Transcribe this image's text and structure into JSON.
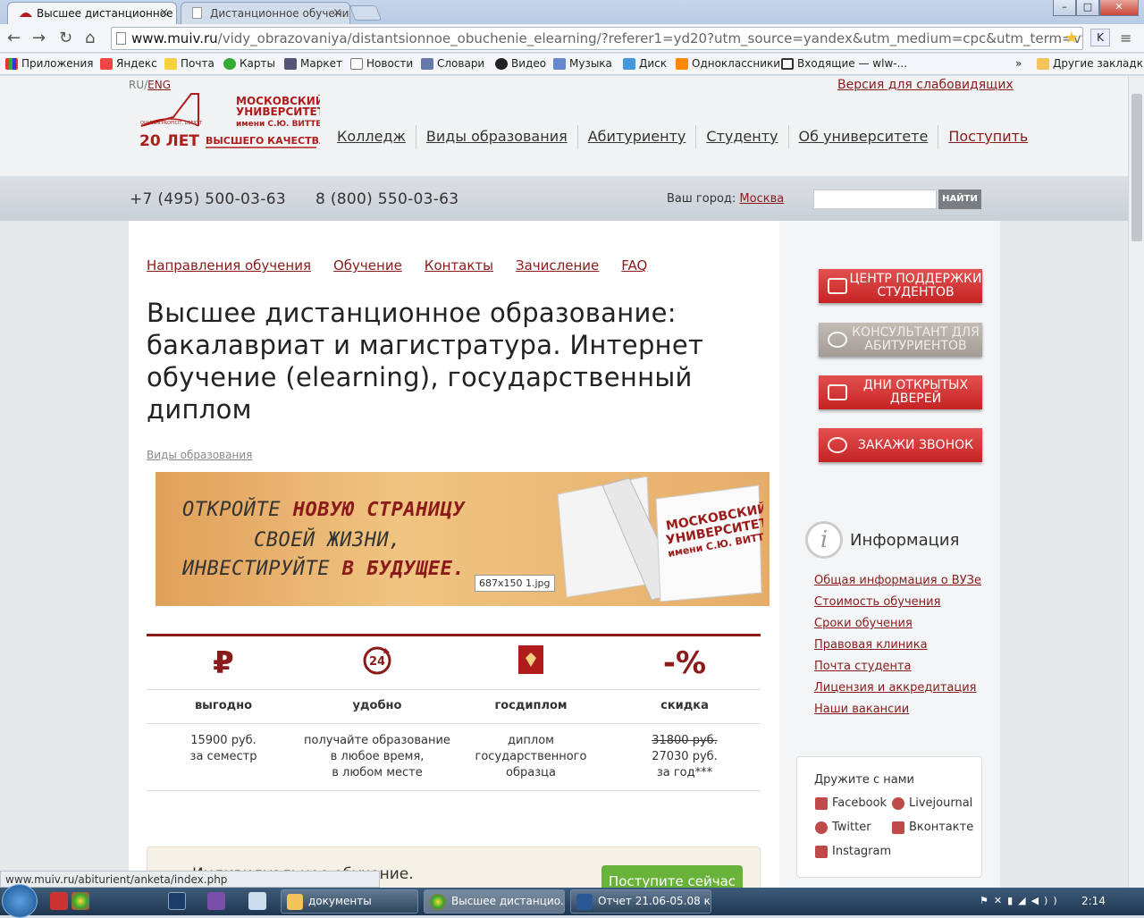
{
  "browser": {
    "tabs": [
      {
        "title": "Высшее дистанционное"
      },
      {
        "title": "Дистанционное обучени"
      }
    ],
    "url_domain": "www.muiv.ru",
    "url_rest": "/vidy_obrazovaniya/distantsionnoe_obuchenie_elearning/?referer1=yd20?utm_source=yandex&utm_medium=cpc&utm_term=vysshee_",
    "bookmarks": [
      "Приложения",
      "Яндекс",
      "Почта",
      "Карты",
      "Маркет",
      "Новости",
      "Словари",
      "Видео",
      "Музыка",
      "Диск",
      "Одноклассники",
      "Входящие — wlw-..."
    ],
    "bookmarks_more": "»",
    "other_bookmarks": "Другие закладки",
    "ext_label": "K",
    "status_url": "www.muiv.ru/abiturient/anketa/index.php"
  },
  "header": {
    "lang_ru": "RU",
    "lang_sep": "/",
    "lang_en": "ENG",
    "low_vision": "Версия для слабовидящих",
    "logo_line1": "МОСКОВСКИЙ",
    "logo_line2": "УНИВЕРСИТЕТ",
    "logo_line3": "имени С.Ю. ВИТТЕ",
    "logo_motto": "QUI NON PROFICIT, DEFICIT",
    "logo_years": "20 ЛЕТ",
    "logo_quality": "ВЫСШЕГО КАЧЕСТВА",
    "nav": [
      "Колледж",
      "Виды образования",
      "Абитуриенту",
      "Студенту",
      "Об университете",
      "Поступить"
    ]
  },
  "phonebar": {
    "phone1": "+7 (495) 500-03-63",
    "phone2": "8 (800) 550-03-63",
    "city_label": "Ваш город:",
    "city": "Москва",
    "search_button": "НАЙТИ"
  },
  "content": {
    "subnav": [
      "Направления обучения",
      "Обучение",
      "Контакты",
      "Зачисление",
      "FAQ"
    ],
    "title": "Высшее дистанционное образование: бакалавриат и магистратура. Интернет обучение (elearning), государственный диплом",
    "breadcrumb": "Виды образования",
    "banner_line1a": "ОТКРОЙТЕ ",
    "banner_line1b": "НОВУЮ СТРАНИЦУ",
    "banner_line2": "СВОЕЙ ЖИЗНИ,",
    "banner_line3a": "ИНВЕСТИРУЙТЕ ",
    "banner_line3b": "В БУДУЩЕЕ.",
    "banner_book_1": "МОСКОВСКИЙ",
    "banner_book_2": "УНИВЕРСИТЕТ",
    "banner_book_3": "имени С.Ю. ВИТТЕ",
    "banner_tooltip": "687x150 1.jpg",
    "features": [
      {
        "icon": "₽",
        "title": "выгодно",
        "l1": "15900 руб.",
        "l2": "за семестр",
        "l3": ""
      },
      {
        "icon": "24",
        "title": "удобно",
        "l1": "получайте образование",
        "l2": "в любое время,",
        "l3": "в любом месте"
      },
      {
        "icon": "",
        "title": "госдиплом",
        "l1": "диплом",
        "l2": "государственного",
        "l3": "образца"
      },
      {
        "icon": "-%",
        "title": "скидка",
        "l1": "31800 руб.",
        "l2": "27030 руб.",
        "l3": "за год***"
      }
    ],
    "cta_text": "Индивидуальное обучение.",
    "cta_button": "Поступите сейчас"
  },
  "sidebar": {
    "btn_support": "ЦЕНТР ПОДДЕРЖКИ СТУДЕНТОВ",
    "btn_consult": "КОНСУЛЬТАНТ ДЛЯ АБИТУРИЕНТОВ",
    "btn_opendays": "ДНИ ОТКРЫТЫХ ДВЕРЕЙ",
    "btn_call": "ЗАКАЖИ ЗВОНОК",
    "info_icon": "i",
    "info_title": "Информация",
    "info_links": [
      "Общая информация о ВУЗе",
      "Стоимость обучения",
      "Сроки обучения",
      "Правовая клиника",
      "Почта студента",
      "Лицензия и аккредитация",
      "Наши вакансии"
    ],
    "social_title": "Дружите с нами",
    "social": [
      "Facebook",
      "Livejournal",
      "Twitter",
      "Вконтакте",
      "Instagram"
    ]
  },
  "taskbar": {
    "windows": [
      "документы",
      "Высшее дистанцио...",
      "Отчет 21.06-05.08 ко..."
    ],
    "clock": "2:14"
  },
  "colors": {
    "brand": "#8b1b1b",
    "button_red": "#d23a3a",
    "green": "#6ab33b"
  }
}
